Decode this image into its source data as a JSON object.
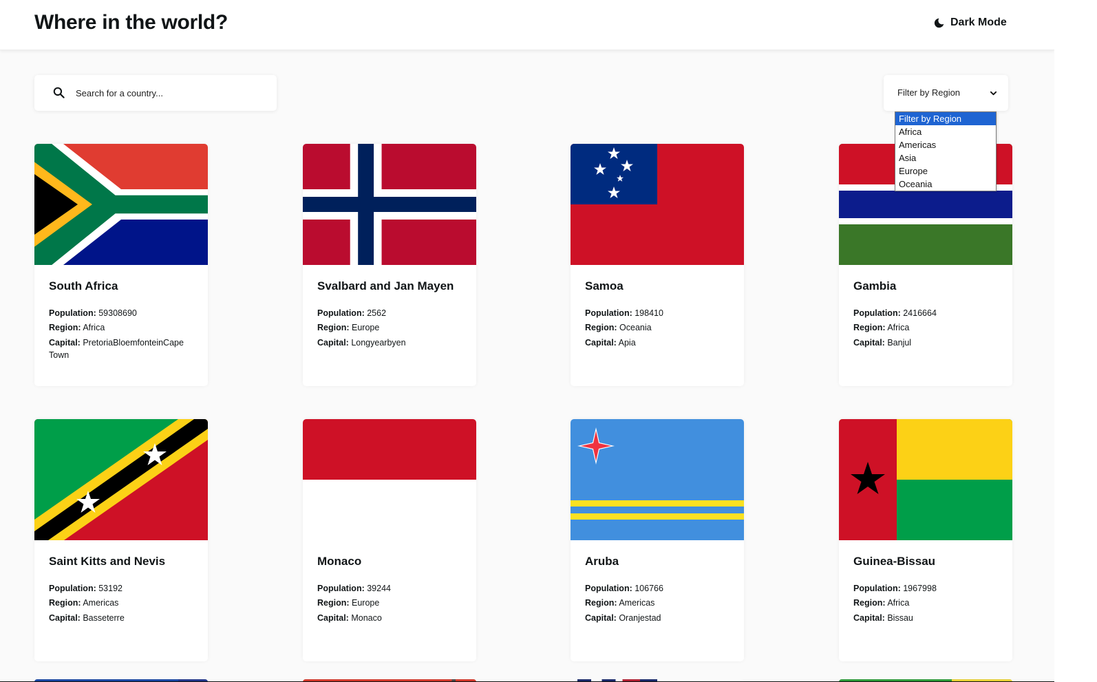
{
  "header": {
    "title": "Where in the world?",
    "dark_mode_label": "Dark Mode"
  },
  "search": {
    "placeholder": "Search for a country..."
  },
  "filter": {
    "label": "Filter by Region",
    "options": [
      "Filter by Region",
      "Africa",
      "Americas",
      "Asia",
      "Europe",
      "Oceania"
    ],
    "selected_index": 0
  },
  "field_labels": {
    "population": "Population:",
    "region": "Region:",
    "capital": "Capital:"
  },
  "countries": [
    {
      "name": "South Africa",
      "population": "59308690",
      "region": "Africa",
      "capital": "PretoriaBloemfonteinCape Town"
    },
    {
      "name": "Svalbard and Jan Mayen",
      "population": "2562",
      "region": "Europe",
      "capital": "Longyearbyen"
    },
    {
      "name": "Samoa",
      "population": "198410",
      "region": "Oceania",
      "capital": "Apia"
    },
    {
      "name": "Gambia",
      "population": "2416664",
      "region": "Africa",
      "capital": "Banjul"
    },
    {
      "name": "Saint Kitts and Nevis",
      "population": "53192",
      "region": "Americas",
      "capital": "Basseterre"
    },
    {
      "name": "Monaco",
      "population": "39244",
      "region": "Europe",
      "capital": "Monaco"
    },
    {
      "name": "Aruba",
      "population": "106766",
      "region": "Americas",
      "capital": "Oranjestad"
    },
    {
      "name": "Guinea-Bissau",
      "population": "1967998",
      "region": "Africa",
      "capital": "Bissau"
    }
  ],
  "colors": {
    "selected_option": "#1e64d2",
    "background": "#fafafa",
    "text": "#111517"
  }
}
